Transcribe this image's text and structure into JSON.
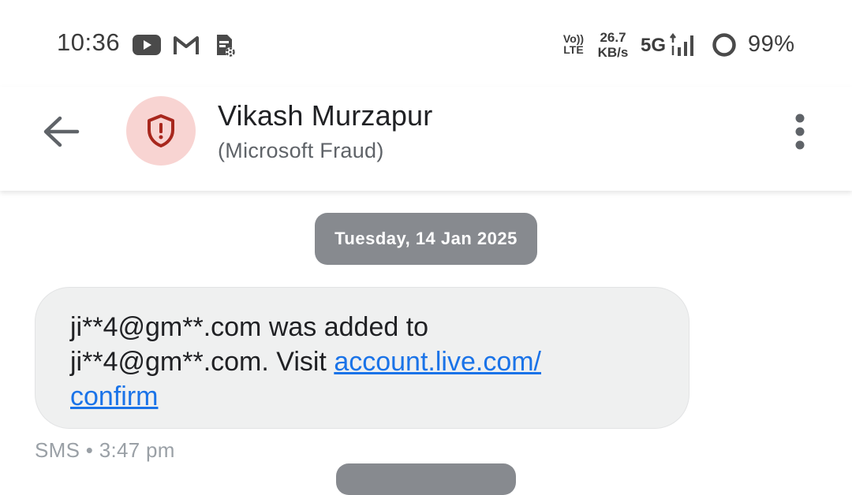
{
  "status_bar": {
    "time": "10:36",
    "left_icons": [
      "youtube-icon",
      "gmail-icon",
      "sim-settings-icon"
    ],
    "volte_top": "Vo))",
    "volte_bottom": "LTE",
    "net_speed_value": "26.7",
    "net_speed_unit": "KB/s",
    "network_type": "5G",
    "battery_percent": "99%"
  },
  "app_bar": {
    "contact_name": "Vikash Murzapur",
    "contact_subtitle": "(Microsoft Fraud)",
    "avatar_icon": "shield-alert-icon",
    "avatar_color": "#f8d4d2",
    "avatar_icon_color": "#a8271d"
  },
  "conversation": {
    "date_label": "Tuesday, 14 Jan 2025",
    "message": {
      "text_line1": "ji**4@gm**.com was added to",
      "text_line2_prefix": "ji**4@gm**.com. Visit ",
      "link_part1": "account.live.com/",
      "link_part2": "confirm",
      "meta": "SMS • 3:47 pm"
    }
  },
  "colors": {
    "link": "#1a73e8",
    "bubble_bg": "#eff0f0",
    "chip_bg": "#878a8f"
  }
}
